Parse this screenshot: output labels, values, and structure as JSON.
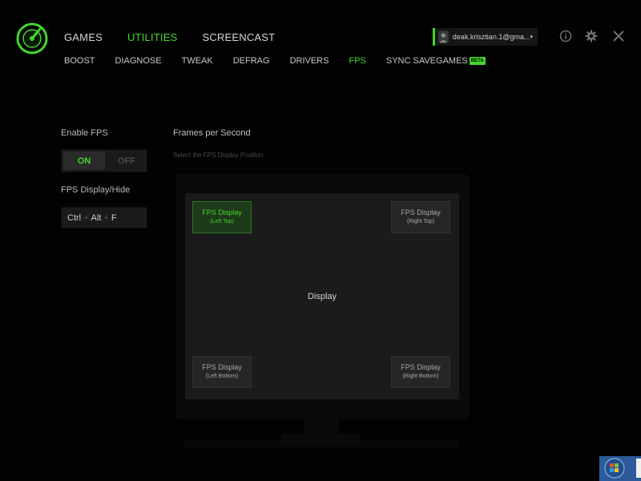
{
  "header": {
    "main_nav": [
      {
        "label": "GAMES",
        "active": false
      },
      {
        "label": "UTILITIES",
        "active": true
      },
      {
        "label": "SCREENCAST",
        "active": false
      }
    ],
    "sub_nav": [
      {
        "label": "BOOST",
        "active": false
      },
      {
        "label": "DIAGNOSE",
        "active": false
      },
      {
        "label": "TWEAK",
        "active": false
      },
      {
        "label": "DEFRAG",
        "active": false
      },
      {
        "label": "DRIVERS",
        "active": false
      },
      {
        "label": "FPS",
        "active": true
      },
      {
        "label": "SYNC SAVEGAMES",
        "active": false,
        "badge": "BETA"
      }
    ],
    "account": {
      "email": "deak.krisztian.1@gma...",
      "caret": "▾"
    },
    "icons": [
      "info-icon",
      "settings-gear-icon",
      "close-icon"
    ]
  },
  "left_panel": {
    "enable_label": "Enable FPS",
    "toggle": {
      "on": "ON",
      "off": "OFF",
      "state": "on"
    },
    "hotkey_label": "FPS Display/Hide",
    "hotkey": {
      "key1": "Ctrl",
      "key2": "Alt",
      "key3": "F",
      "separator": "+"
    }
  },
  "right_panel": {
    "title": "Frames per Second",
    "subtitle": "Select the FPS Display Position",
    "display_label": "Display",
    "positions": {
      "left_top": {
        "line1": "FPS Display",
        "line2": "(Left Top)",
        "selected": true
      },
      "right_top": {
        "line1": "FPS Display",
        "line2": "(Right Top)",
        "selected": false
      },
      "left_bottom": {
        "line1": "FPS Display",
        "line2": "(Left Bottom)",
        "selected": false
      },
      "right_bottom": {
        "line1": "FPS Display",
        "line2": "(Right Bottom)",
        "selected": false
      }
    }
  },
  "colors": {
    "accent": "#44d62c",
    "background": "#020202",
    "panel": "#1b1b1b"
  }
}
